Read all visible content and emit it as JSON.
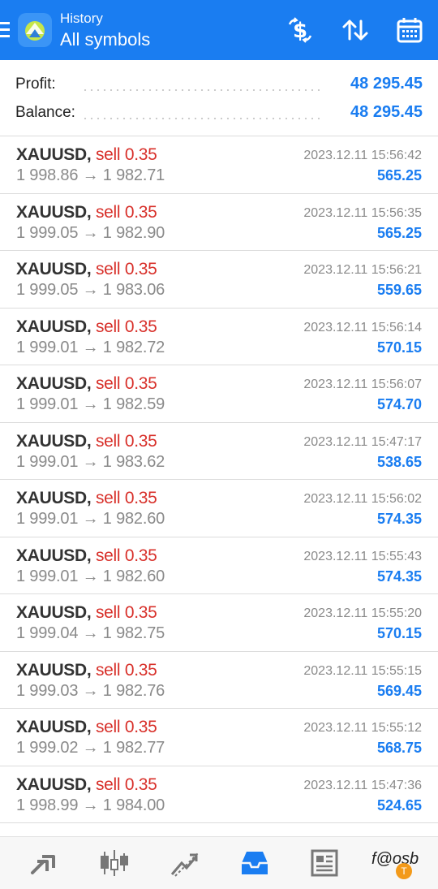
{
  "header": {
    "subtitle": "History",
    "title": "All symbols",
    "accent": "#1a7df1"
  },
  "summary": {
    "profit_label": "Profit:",
    "profit_value": "48 295.45",
    "balance_label": "Balance:",
    "balance_value": "48 295.45"
  },
  "trades": [
    {
      "symbol": "XAUUSD,",
      "type": "sell 0.35",
      "open": "1 998.86",
      "close": "1 982.71",
      "time": "2023.12.11 15:56:42",
      "profit": "565.25"
    },
    {
      "symbol": "XAUUSD,",
      "type": "sell 0.35",
      "open": "1 999.05",
      "close": "1 982.90",
      "time": "2023.12.11 15:56:35",
      "profit": "565.25"
    },
    {
      "symbol": "XAUUSD,",
      "type": "sell 0.35",
      "open": "1 999.05",
      "close": "1 983.06",
      "time": "2023.12.11 15:56:21",
      "profit": "559.65"
    },
    {
      "symbol": "XAUUSD,",
      "type": "sell 0.35",
      "open": "1 999.01",
      "close": "1 982.72",
      "time": "2023.12.11 15:56:14",
      "profit": "570.15"
    },
    {
      "symbol": "XAUUSD,",
      "type": "sell 0.35",
      "open": "1 999.01",
      "close": "1 982.59",
      "time": "2023.12.11 15:56:07",
      "profit": "574.70"
    },
    {
      "symbol": "XAUUSD,",
      "type": "sell 0.35",
      "open": "1 999.01",
      "close": "1 983.62",
      "time": "2023.12.11 15:47:17",
      "profit": "538.65"
    },
    {
      "symbol": "XAUUSD,",
      "type": "sell 0.35",
      "open": "1 999.01",
      "close": "1 982.60",
      "time": "2023.12.11 15:56:02",
      "profit": "574.35"
    },
    {
      "symbol": "XAUUSD,",
      "type": "sell 0.35",
      "open": "1 999.01",
      "close": "1 982.60",
      "time": "2023.12.11 15:55:43",
      "profit": "574.35"
    },
    {
      "symbol": "XAUUSD,",
      "type": "sell 0.35",
      "open": "1 999.04",
      "close": "1 982.75",
      "time": "2023.12.11 15:55:20",
      "profit": "570.15"
    },
    {
      "symbol": "XAUUSD,",
      "type": "sell 0.35",
      "open": "1 999.03",
      "close": "1 982.76",
      "time": "2023.12.11 15:55:15",
      "profit": "569.45"
    },
    {
      "symbol": "XAUUSD,",
      "type": "sell 0.35",
      "open": "1 999.02",
      "close": "1 982.77",
      "time": "2023.12.11 15:55:12",
      "profit": "568.75"
    },
    {
      "symbol": "XAUUSD,",
      "type": "sell 0.35",
      "open": "1 998.99",
      "close": "1 984.00",
      "time": "2023.12.11 15:47:36",
      "profit": "524.65"
    }
  ],
  "arrow": "→",
  "colors": {
    "sell": "#d8302a",
    "profit": "#1a7df1",
    "muted": "#8a8a8a"
  },
  "bottom_nav": {
    "items": [
      "quotes-icon",
      "chart-icon",
      "trade-icon",
      "history-icon",
      "news-icon"
    ],
    "active": "history-icon",
    "watermark": "f@osb",
    "badge": "T"
  }
}
